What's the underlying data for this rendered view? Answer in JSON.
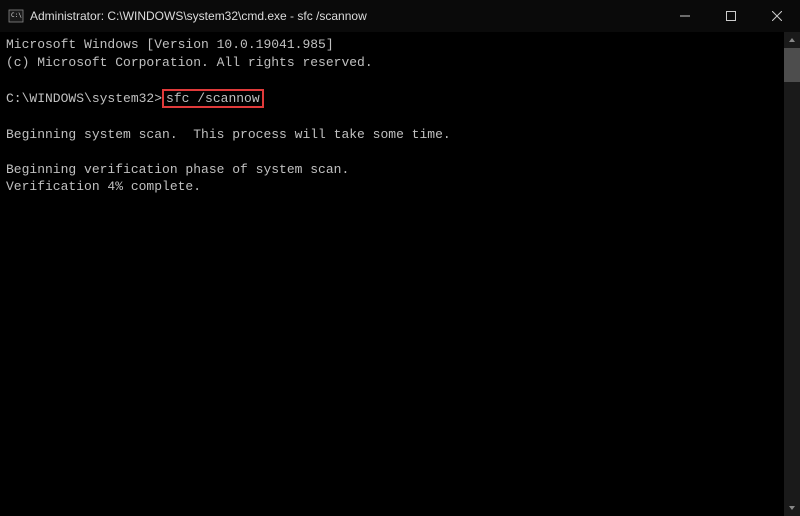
{
  "titlebar": {
    "title": "Administrator: C:\\WINDOWS\\system32\\cmd.exe - sfc  /scannow"
  },
  "terminal": {
    "line1": "Microsoft Windows [Version 10.0.19041.985]",
    "line2": "(c) Microsoft Corporation. All rights reserved.",
    "prompt": "C:\\WINDOWS\\system32>",
    "command": "sfc /scannow",
    "line4": "Beginning system scan.  This process will take some time.",
    "line5": "Beginning verification phase of system scan.",
    "line6": "Verification 4% complete."
  }
}
